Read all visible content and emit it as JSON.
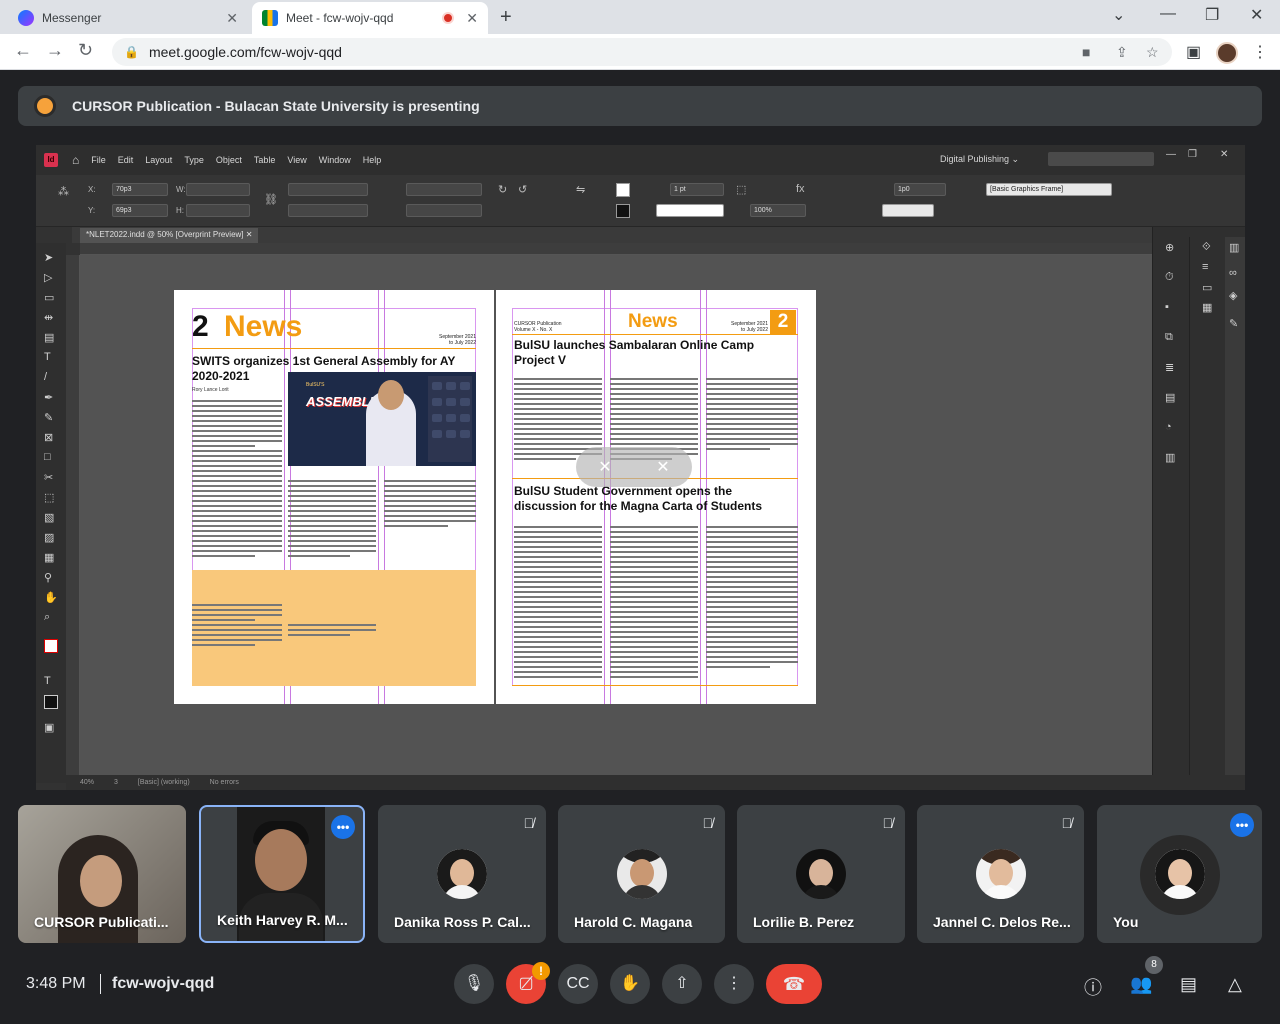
{
  "browser": {
    "tabs": [
      {
        "title": "Messenger",
        "icon": "messenger-icon",
        "active": false
      },
      {
        "title": "Meet - fcw-wojv-qqd",
        "icon": "meet-icon",
        "active": true,
        "recording": true
      }
    ],
    "url": "meet.google.com/fcw-wojv-qqd"
  },
  "presenting": {
    "text": "CURSOR Publication - Bulacan State University is presenting"
  },
  "indesign": {
    "menu": [
      "File",
      "Edit",
      "Layout",
      "Type",
      "Object",
      "Table",
      "View",
      "Window",
      "Help"
    ],
    "workspace": "Digital Publishing",
    "control": {
      "x": "70p3",
      "y": "69p3",
      "stroke": "1 pt",
      "opacity": "100%",
      "gap": "1p0",
      "frame_style": "[Basic Graphics Frame]"
    },
    "doc_tab": "*NLET2022.indd @ 50% [Overprint Preview]",
    "status": {
      "zoom": "40%",
      "page": "3",
      "style": "[Basic] (working)",
      "errors": "No errors"
    }
  },
  "document": {
    "left": {
      "page_num": "2",
      "section": "News",
      "date": "September 2021\nto July 2022",
      "headline": "SWITS organizes 1st General Assembly for AY 2020-2021",
      "author": "Rory Lance Lorit",
      "photo_title": "ASSEMBLE",
      "photo_kicker": "BulSU'S"
    },
    "right": {
      "page_num": "2",
      "section": "News",
      "masthead": "CURSOR Publication\nVolume X - No. X",
      "date": "September 2021\nto July 2022",
      "headline1": "BulSU launches Sambalaran Online Camp Project V",
      "headline2": "BulSU Student Government opens the discussion for the Magna Carta of Students"
    }
  },
  "participants": [
    {
      "name": "CURSOR Publicati...",
      "type": "camera",
      "speaking": false,
      "muted": false
    },
    {
      "name": "Keith Harvey R. M...",
      "type": "camera",
      "speaking": true,
      "muted": false
    },
    {
      "name": "Danika Ross P. Cal...",
      "type": "avatar",
      "muted": true
    },
    {
      "name": "Harold C. Magana",
      "type": "avatar",
      "muted": true
    },
    {
      "name": "Lorilie B. Perez",
      "type": "avatar",
      "muted": true
    },
    {
      "name": "Jannel C. Delos Re...",
      "type": "avatar",
      "muted": true
    },
    {
      "name": "You",
      "type": "avatar",
      "muted": false,
      "speaking": true
    }
  ],
  "meeting": {
    "time": "3:48 PM",
    "code": "fcw-wojv-qqd",
    "people_count": "8",
    "alert": "!"
  },
  "colors": {
    "meet_bg": "#202124",
    "tile_bg": "#3c4043",
    "end_call": "#ea4335",
    "accent_blue": "#1a73e8",
    "news_orange": "#f39c12"
  }
}
